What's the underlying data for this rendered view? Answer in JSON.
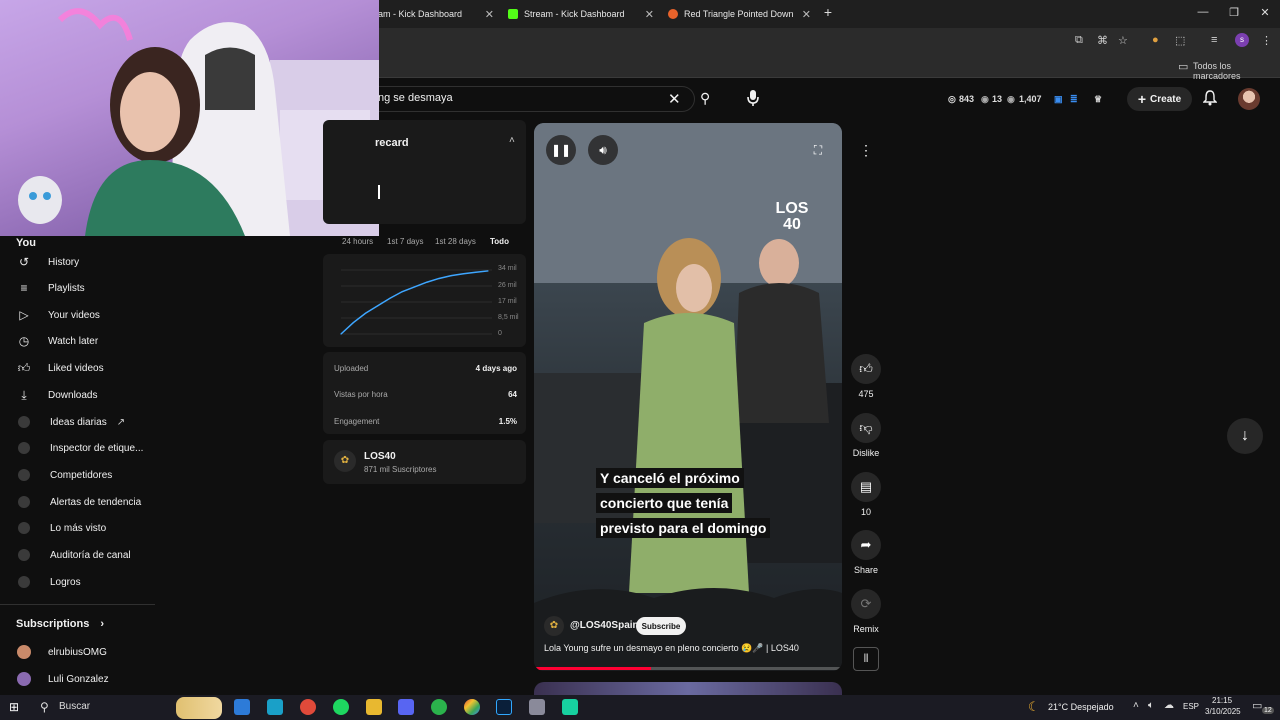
{
  "browser": {
    "tabs": [
      {
        "label": "am - Kick Dashboard",
        "color": "#53fc18"
      },
      {
        "label": "Stream - Kick Dashboard",
        "color": "#53fc18"
      },
      {
        "label": "Red Triangle Pointed Down",
        "color": "#e8632b"
      }
    ],
    "bookmarks_all_label": "Todos los marcadores"
  },
  "youtube": {
    "search_query": "ng se desmaya",
    "stats": {
      "a": "843",
      "b": "13",
      "c": "1,407"
    },
    "create_label": "Create"
  },
  "sidebar": {
    "you_label": "You",
    "items": [
      {
        "label": "History",
        "icon": "history-icon"
      },
      {
        "label": "Playlists",
        "icon": "playlists-icon"
      },
      {
        "label": "Your videos",
        "icon": "your-videos-icon"
      },
      {
        "label": "Watch later",
        "icon": "watch-later-icon"
      },
      {
        "label": "Liked videos",
        "icon": "liked-videos-icon"
      },
      {
        "label": "Downloads",
        "icon": "downloads-icon"
      }
    ],
    "ext_items": [
      {
        "label": "Ideas diarias"
      },
      {
        "label": "Inspector de etique..."
      },
      {
        "label": "Competidores"
      },
      {
        "label": "Alertas de tendencia"
      },
      {
        "label": "Lo más visto"
      },
      {
        "label": "Auditoría de canal"
      },
      {
        "label": "Logros"
      }
    ],
    "subscriptions_label": "Subscriptions",
    "subscriptions": [
      {
        "label": "elrubiusOMG"
      },
      {
        "label": "Luli Gonzalez"
      }
    ]
  },
  "panel": {
    "title": "recard",
    "ranges": [
      "24 hours",
      "1st 7 days",
      "1st 28 days",
      "Todo"
    ],
    "active_range": "Todo",
    "y_ticks": [
      "34 mil",
      "26 mil",
      "17 mil",
      "8,5 mil",
      "0"
    ],
    "rows": [
      {
        "label": "Uploaded",
        "value": "4 days ago"
      },
      {
        "label": "Vistas por hora",
        "value": "64"
      },
      {
        "label": "Engagement",
        "value": "1.5%"
      }
    ],
    "channel": {
      "name": "LOS40",
      "subs": "871 mil Suscriptores"
    }
  },
  "video": {
    "captions": [
      "Y canceló el próximo",
      "concierto que tenía",
      "previsto para el domingo"
    ],
    "channel_handle": "@LOS40Spain",
    "subscribe_label": "Subscribe",
    "title": "Lola Young sufre un desmayo en pleno concierto 😢🎤 | LOS40",
    "logo_text": "LOS 40",
    "progress": 0.38
  },
  "actions": {
    "likes": "475",
    "dislike": "Dislike",
    "comments": "10",
    "share": "Share",
    "remix": "Remix"
  },
  "chart_data": {
    "type": "line",
    "x": [
      0,
      1,
      2,
      3,
      4,
      5,
      6,
      7,
      8,
      9,
      10,
      11,
      12
    ],
    "values": [
      0,
      6000,
      11000,
      15000,
      19000,
      22500,
      25000,
      27500,
      29500,
      31000,
      32000,
      32800,
      33500
    ],
    "ylim": [
      0,
      34000
    ]
  },
  "taskbar": {
    "search_label": "Buscar",
    "weather": "21°C Despejado",
    "lang": "ESP",
    "time": "21:15",
    "date": "3/10/2025",
    "notif_count": "12"
  }
}
